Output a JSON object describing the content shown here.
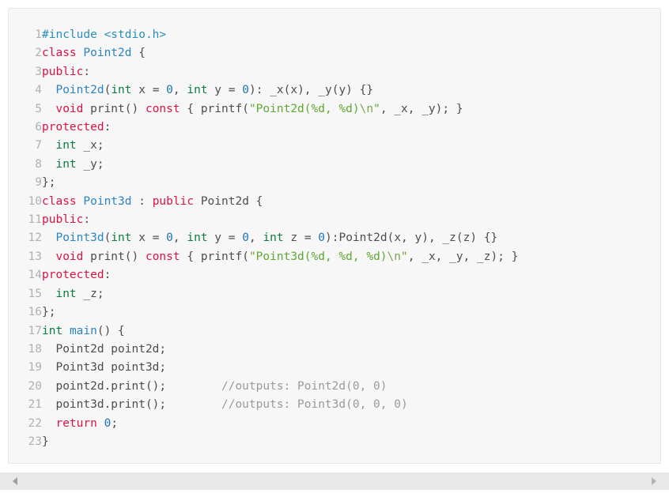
{
  "code_block": {
    "language": "cpp",
    "background_color": "#f7f7f7",
    "border_color": "#e6e6e6",
    "colors": {
      "keyword": "#d14",
      "type": "#0a7d3e",
      "class_name": "#2b84c4",
      "number": "#1d75b3",
      "string": "#5fa832",
      "preprocessor": "#2a8fb5",
      "comment": "#9a9a9a",
      "plain": "#4d4d4d",
      "line_number": "#b0b0b0"
    },
    "line_numbers": [
      "1",
      "2",
      "3",
      "4",
      "5",
      "6",
      "7",
      "8",
      "9",
      "10",
      "11",
      "12",
      "13",
      "14",
      "15",
      "16",
      "17",
      "18",
      "19",
      "20",
      "21",
      "22",
      "23"
    ],
    "lines": [
      "#include <stdio.h>",
      "class Point2d {",
      "public:",
      "  Point2d(int x = 0, int y = 0): _x(x), _y(y) {}",
      "  void print() const { printf(\"Point2d(%d, %d)\\n\", _x, _y); }",
      "protected:",
      "  int _x;",
      "  int _y;",
      "};",
      "class Point3d : public Point2d {",
      "public:",
      "  Point3d(int x = 0, int y = 0, int z = 0):Point2d(x, y), _z(z) {}",
      "  void print() const { printf(\"Point3d(%d, %d, %d)\\n\", _x, _y, _z); }",
      "protected:",
      "  int _z;",
      "};",
      "int main() {",
      "  Point2d point2d;",
      "  Point3d point3d;",
      "  point2d.print();        //outputs: Point2d(0, 0)",
      "  point3d.print();        //outputs: Point3d(0, 0, 0)",
      "  return 0;",
      "}"
    ],
    "comments": [
      "//outputs: Point2d(0, 0)",
      "//outputs: Point3d(0, 0, 0)"
    ],
    "strings": [
      "\"Point2d(%d, %d)\\n\"",
      "\"Point3d(%d, %d, %d)\\n\""
    ],
    "keywords": [
      "class",
      "public",
      "protected",
      "void",
      "const",
      "return"
    ],
    "types": [
      "int"
    ],
    "identifiers": [
      "Point2d",
      "Point3d",
      "main",
      "print",
      "printf",
      "_x",
      "_y",
      "_z",
      "point2d",
      "point3d",
      "x",
      "y",
      "z"
    ],
    "preprocessor": "#include <stdio.h>"
  },
  "scrollbar": {
    "orientation": "horizontal",
    "left_arrow": "triangle-left-icon",
    "right_arrow": "triangle-right-icon"
  }
}
